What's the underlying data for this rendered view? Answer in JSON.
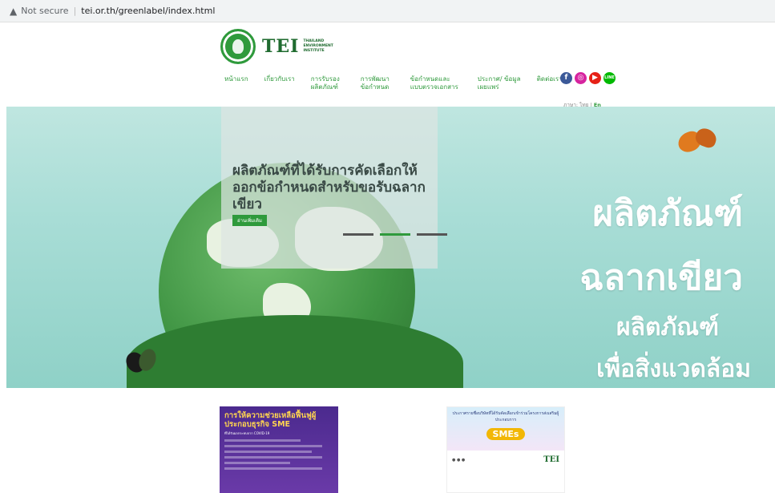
{
  "browser": {
    "security_label": "Not secure",
    "url": "tei.or.th/greenlabel/index.html"
  },
  "logo": {
    "brand": "TEI",
    "subtitle": "THAILAND ENVIRONMENT INSTITUTE"
  },
  "nav": {
    "items": [
      {
        "label": "หน้าแรก"
      },
      {
        "label": "เกี่ยวกับเรา"
      },
      {
        "label": "การรับรอง ผลิตภัณฑ์"
      },
      {
        "label": "การพัฒนา ข้อกำหนด"
      },
      {
        "label": "ข้อกำหนดและ แบบตรวจเอกสาร"
      },
      {
        "label": "ประกาศ/ ข้อมูลเผยแพร่"
      },
      {
        "label": "ติดต่อเรา"
      }
    ]
  },
  "social": {
    "icons": [
      "facebook-icon",
      "instagram-icon",
      "youtube-icon",
      "line-icon"
    ],
    "line_label": "LINE"
  },
  "language": {
    "label": "ภาษา: ไทย |",
    "en": "En"
  },
  "hero": {
    "slide_title": "ผลิตภัณฑ์ที่ได้รับการคัดเลือกให้ออกข้อกำหนดสำหรับขอรับฉลากเขียว",
    "read_more": "อ่านเพิ่มเติม",
    "line1": "ผลิตภัณฑ์",
    "line2": "ฉลากเขียว",
    "line3": "ผลิตภัณฑ์",
    "line4": "เพื่อสิ่งแวดล้อม",
    "active_slide": 2,
    "slide_count": 3
  },
  "cards": {
    "covid_title": "การให้ความช่วยเหลือฟื้นฟูผู้ประกอบธุรกิจ SME",
    "covid_sub": "ที่ได้รับผลกระทบจาก COVID-19",
    "sme_heading": "ประกาศรายชื่อบริษัทที่ได้รับคัดเลือกเข้าร่วมโครงการส่งเสริมผู้ประกอบการ",
    "sme_badge": "SMEs",
    "sme_logo": "TEI"
  },
  "colors": {
    "brand_green": "#2f9a3c",
    "hero_sky": "#a8ddd6"
  }
}
